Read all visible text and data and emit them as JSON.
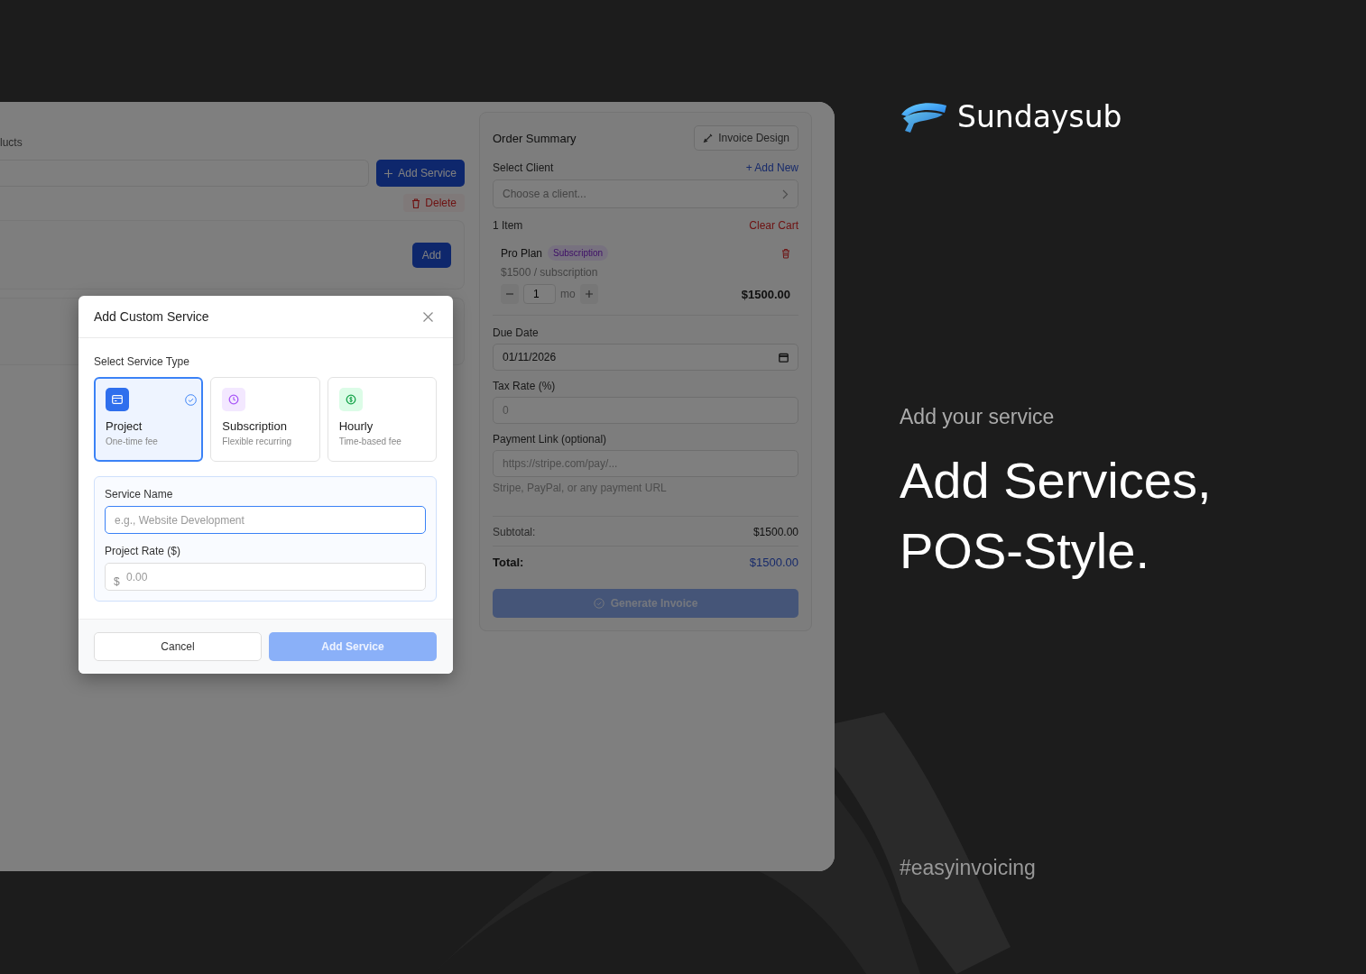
{
  "products_panel": {
    "title": "lucts",
    "add_service_button": "Add Service",
    "delete_button": "Delete",
    "add_button": "Add"
  },
  "order_summary": {
    "title": "Order Summary",
    "invoice_design_button": "Invoice Design",
    "client_label": "Select Client",
    "add_new_link": "+ Add New",
    "client_placeholder": "Choose a client...",
    "item_count": "1 Item",
    "clear_cart": "Clear Cart",
    "items": [
      {
        "name": "Pro Plan",
        "badge": "Subscription",
        "price": "$1500 / subscription",
        "quantity": "1",
        "unit": "mo",
        "total": "$1500.00"
      }
    ],
    "due_date_label": "Due Date",
    "due_date": "01/11/2026",
    "tax_label": "Tax Rate (%)",
    "tax_placeholder": "0",
    "payment_label": "Payment Link (optional)",
    "payment_placeholder": "https://stripe.com/pay/...",
    "payment_hint": "Stripe, PayPal, or any payment URL",
    "subtotal_label": "Subtotal:",
    "subtotal": "$1500.00",
    "total_label": "Total:",
    "total": "$1500.00",
    "generate_button": "Generate Invoice",
    "generate_disabled": true
  },
  "modal": {
    "title": "Add Custom Service",
    "type_label": "Select Service Type",
    "service_types": [
      {
        "kind": "project",
        "title": "Project",
        "subtitle": "One-time fee",
        "selected": true
      },
      {
        "kind": "subscription",
        "title": "Subscription",
        "subtitle": "Flexible recurring",
        "selected": false
      },
      {
        "kind": "hourly",
        "title": "Hourly",
        "subtitle": "Time-based fee",
        "selected": false
      }
    ],
    "name_label": "Service Name",
    "name_placeholder": "e.g., Website Development",
    "rate_label": "Project Rate ($)",
    "currency": "$",
    "rate_placeholder": "0.00",
    "cancel_button": "Cancel",
    "submit_button": "Add Service",
    "submit_disabled": true
  },
  "brand": {
    "name": "Sundaysub"
  },
  "promo": {
    "eyebrow": "Add your service",
    "headline_lines": [
      "Add Services,",
      "POS-Style."
    ],
    "hashtag": "#easyinvoicing"
  }
}
